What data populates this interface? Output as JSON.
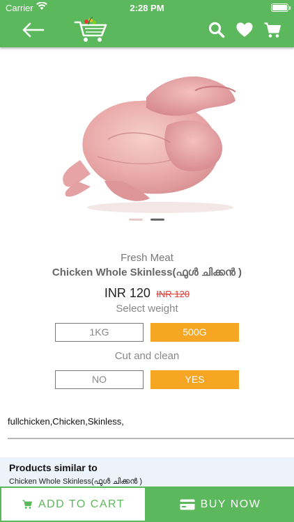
{
  "status_bar": {
    "carrier": "Carrier",
    "time": "2:28 PM"
  },
  "header": {
    "background": "#5cb85c",
    "icons": [
      "back-arrow-icon",
      "cart-logo-icon",
      "search-icon",
      "heart-icon",
      "cart-icon"
    ]
  },
  "product": {
    "image": "whole-chicken-image",
    "carousel_pages": 2,
    "carousel_active_page": 2,
    "category": "Fresh Meat",
    "title": "Chicken Whole Skinless(ഫുൾ ചിക്കൻ )",
    "price": "INR 120",
    "price_old": "INR 120",
    "select_weight_label": "Select weight",
    "weight_options": [
      {
        "label": "1KG",
        "selected": false
      },
      {
        "label": "500G",
        "selected": true
      }
    ],
    "cut_label": "Cut and clean",
    "cut_options": [
      {
        "label": "NO",
        "selected": false
      },
      {
        "label": "YES",
        "selected": true
      }
    ],
    "tags": "fullchicken,Chicken,Skinless,"
  },
  "similar": {
    "title": "Products similar to",
    "item": "Chicken Whole Skinless(ഫുൾ ചിക്കൻ )"
  },
  "bottom_bar": {
    "add_to_cart": "ADD TO CART",
    "buy_now": "BUY NOW"
  },
  "colors": {
    "brand_green": "#5cb85c",
    "selected_orange": "#f6a623",
    "strike_red": "#e53935"
  }
}
